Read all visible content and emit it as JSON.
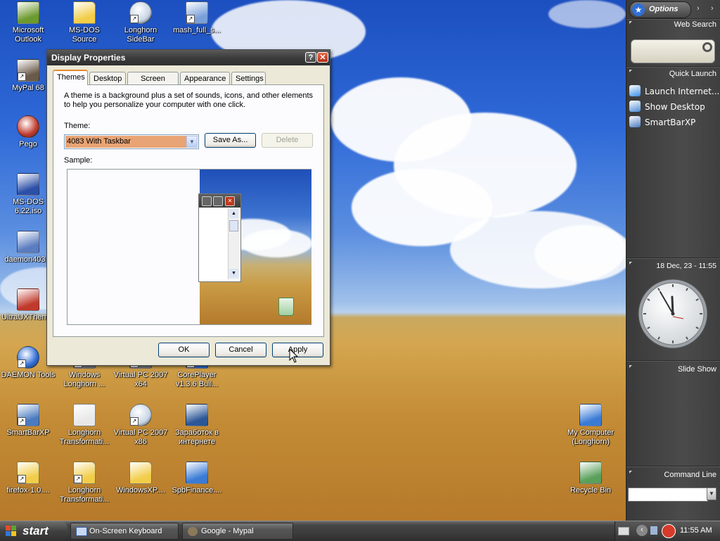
{
  "desktop": {
    "icons": [
      {
        "label": "Microsoft Outlook",
        "icon": "outlook-icon",
        "color": "#6b9a2e"
      },
      {
        "label": "MS-DOS Source",
        "icon": "folder-icon",
        "color": "#f2cd4a"
      },
      {
        "label": "Longhorn SideBar",
        "icon": "disc-icon",
        "color": "#c9d6e6"
      },
      {
        "label": "mash_full_s...",
        "icon": "installer-icon",
        "color": "#7aa0d8"
      },
      {
        "label": "MyPal 68",
        "icon": "raccoon-icon",
        "color": "#6a5a4a"
      },
      {
        "label": "Pego",
        "icon": "red-ball-icon",
        "color": "#c0392b"
      },
      {
        "label": "MS-DOS 6.22.iso",
        "icon": "iso-file-icon",
        "color": "#2c4fa8"
      },
      {
        "label": "daemon403...",
        "icon": "daemon-installer-icon",
        "color": "#5a7cc0"
      },
      {
        "label": "UltraUXThem...",
        "icon": "monitor-icon",
        "color": "#c0392b"
      },
      {
        "label": "DAEMON Tools",
        "icon": "daemon-tools-icon",
        "color": "#2b6bd6"
      },
      {
        "label": "Windows Longhorn ...",
        "icon": "window-icon",
        "color": "#7a7a7a"
      },
      {
        "label": "Virtual PC 2007 x64",
        "icon": "virtual-pc-icon",
        "color": "#7a7a7a"
      },
      {
        "label": "CorePlayer v1.3.6 Buil...",
        "icon": "coreplayer-icon",
        "color": "#2b6bd6"
      },
      {
        "label": "SmartBarXP",
        "icon": "smartbar-icon",
        "color": "#4a7ac0"
      },
      {
        "label": "Longhorn Transformati...",
        "icon": "7z-archive-icon",
        "color": "#e8e8e8"
      },
      {
        "label": "Virtual PC 2007 x86",
        "icon": "cd-icon",
        "color": "#c9d6e6"
      },
      {
        "label": "Заработок в интернете",
        "icon": "word-document-icon",
        "color": "#2b5797"
      },
      {
        "label": "firefox-1.0....",
        "icon": "zip-folder-icon",
        "color": "#f2cd4a"
      },
      {
        "label": "Longhorn Transformati...",
        "icon": "folder-icon",
        "color": "#f2cd4a"
      },
      {
        "label": "WindowsXP....",
        "icon": "zip-folder-icon",
        "color": "#f2cd4a"
      },
      {
        "label": "SpbFinance....",
        "icon": "finance-app-icon",
        "color": "#3a7bd5"
      },
      {
        "label": "My Computer (Longhorn)",
        "icon": "my-computer-icon",
        "color": "#3a7bd5"
      },
      {
        "label": "Recycle Bin",
        "icon": "recycle-bin-icon",
        "color": "#5aa05a"
      }
    ]
  },
  "sidebar": {
    "options_label": "Options",
    "web_search_label": "Web Search",
    "quick_launch_label": "Quick Launch",
    "quick_launch_items": [
      {
        "label": "Launch Internet...",
        "icon": "internet-explorer-icon",
        "color": "#3a8ee6"
      },
      {
        "label": "Show Desktop",
        "icon": "show-desktop-icon",
        "color": "#4a8ad6"
      },
      {
        "label": "SmartBarXP",
        "icon": "smartbar-icon",
        "color": "#4a7ac0"
      }
    ],
    "clock_label": "18 Dec, 23 - 11:55",
    "clock": {
      "hour": 11,
      "minute": 55
    },
    "slide_show_label": "Slide Show",
    "command_line_label": "Command Line"
  },
  "dialog": {
    "title": "Display Properties",
    "help_button": "?",
    "close_button": "✕",
    "tabs": [
      "Themes",
      "Desktop",
      "Screen Saver",
      "Appearance",
      "Settings"
    ],
    "active_tab": "Themes",
    "description": "A theme is a background plus a set of sounds, icons, and other elements to help you personalize your computer with one click.",
    "theme_label": "Theme:",
    "theme_value": "4083 With Taskbar",
    "save_as_label": "Save As...",
    "delete_label": "Delete",
    "sample_label": "Sample:",
    "ok_label": "OK",
    "cancel_label": "Cancel",
    "apply_label": "Apply"
  },
  "taskbar": {
    "start_label": "start",
    "tasks": [
      {
        "label": "On-Screen Keyboard",
        "icon": "keyboard-icon"
      },
      {
        "label": "Google - Mypal",
        "icon": "mypal-icon"
      }
    ],
    "time": "11:55 AM"
  },
  "colors": {
    "accent_tab": "#e68b2c",
    "selected_theme": "#e8a474",
    "titlebar": "#3c3c3c"
  }
}
